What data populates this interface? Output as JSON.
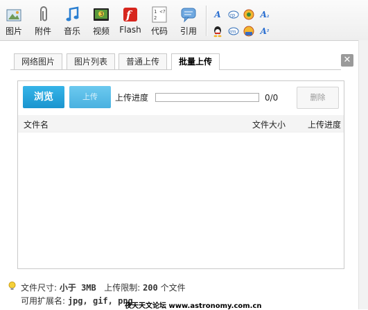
{
  "toolbar": {
    "items": [
      {
        "label": "图片",
        "icon": "image-icon"
      },
      {
        "label": "附件",
        "icon": "paperclip-icon"
      },
      {
        "label": "音乐",
        "icon": "music-note-icon"
      },
      {
        "label": "视频",
        "icon": "video-icon"
      },
      {
        "label": "Flash",
        "icon": "flash-icon"
      },
      {
        "label": "代码",
        "icon": "code-icon"
      },
      {
        "label": "引用",
        "icon": "quote-icon"
      }
    ],
    "small_icons": [
      "A",
      "rp",
      "qq",
      "A₂",
      "qq2",
      "rm",
      "qq3",
      "A²"
    ]
  },
  "tabs": [
    {
      "label": "网络图片"
    },
    {
      "label": "图片列表"
    },
    {
      "label": "普通上传"
    },
    {
      "label": "批量上传"
    }
  ],
  "close_symbol": "✕",
  "uploader": {
    "browse_label": "浏览",
    "upload_label": "上传",
    "progress_label": "上传进度",
    "progress_fraction": 0,
    "progress_count": "0/0",
    "delete_label": "删除"
  },
  "list_header": {
    "filename": "文件名",
    "filesize": "文件大小",
    "progress": "上传进度"
  },
  "footer": {
    "size_label": "文件尺寸: ",
    "size_value": "小于 3MB",
    "limit_label": "上传限制: ",
    "limit_value": "200",
    "limit_unit": " 个文件",
    "ext_label": "可用扩展名: ",
    "ext_value": "jpg, gif, png"
  },
  "watermark": "夜天天文论坛 www.astronomy.com.cn"
}
